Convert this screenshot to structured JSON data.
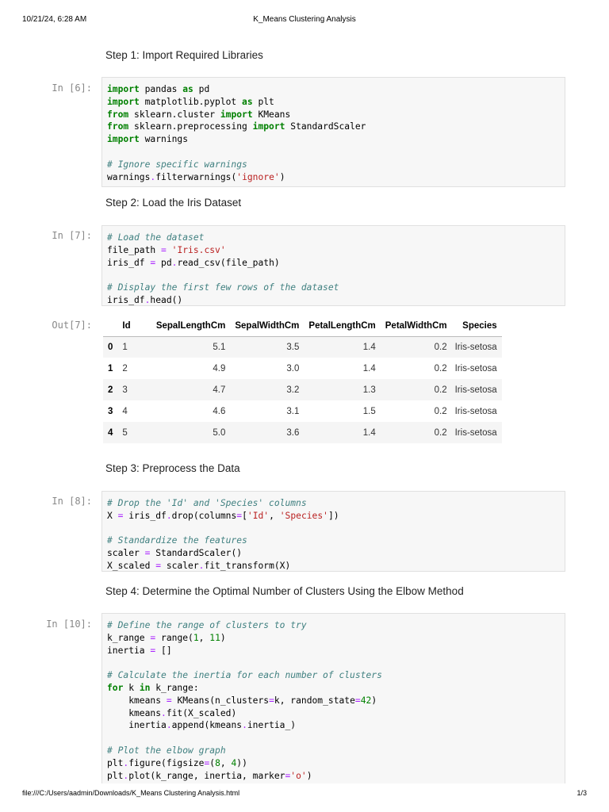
{
  "header": {
    "datetime": "10/21/24, 6:28 AM",
    "title": "K_Means Clustering Analysis"
  },
  "footer": {
    "path": "file:///C:/Users/aadmin/Downloads/K_Means Clustering Analysis.html",
    "page": "1/3"
  },
  "steps": [
    "Step 1: Import Required Libraries",
    "Step 2: Load the Iris Dataset",
    "Step 3: Preprocess the Data",
    "Step 4: Determine the Optimal Number of Clusters Using the Elbow Method"
  ],
  "cells": [
    {
      "prompt": "In [6]:",
      "lines": [
        [
          [
            "k",
            "import"
          ],
          [
            "p",
            " pandas "
          ],
          [
            "k",
            "as"
          ],
          [
            "p",
            " pd"
          ]
        ],
        [
          [
            "k",
            "import"
          ],
          [
            "p",
            " matplotlib.pyplot "
          ],
          [
            "k",
            "as"
          ],
          [
            "p",
            " plt"
          ]
        ],
        [
          [
            "k",
            "from"
          ],
          [
            "p",
            " sklearn.cluster "
          ],
          [
            "k",
            "import"
          ],
          [
            "p",
            " KMeans"
          ]
        ],
        [
          [
            "k",
            "from"
          ],
          [
            "p",
            " sklearn.preprocessing "
          ],
          [
            "k",
            "import"
          ],
          [
            "p",
            " StandardScaler"
          ]
        ],
        [
          [
            "k",
            "import"
          ],
          [
            "p",
            " warnings"
          ]
        ],
        [],
        [
          [
            "c",
            "# Ignore specific warnings"
          ]
        ],
        [
          [
            "p",
            "warnings"
          ],
          [
            "o",
            "."
          ],
          [
            "p",
            "filterwarnings("
          ],
          [
            "s",
            "'ignore'"
          ],
          [
            "p",
            ")"
          ]
        ]
      ]
    },
    {
      "prompt": "In [7]:",
      "lines": [
        [
          [
            "c",
            "# Load the dataset"
          ]
        ],
        [
          [
            "p",
            "file_path "
          ],
          [
            "o",
            "="
          ],
          [
            "p",
            " "
          ],
          [
            "s",
            "'Iris.csv'"
          ]
        ],
        [
          [
            "p",
            "iris_df "
          ],
          [
            "o",
            "="
          ],
          [
            "p",
            " pd"
          ],
          [
            "o",
            "."
          ],
          [
            "p",
            "read_csv(file_path)"
          ]
        ],
        [],
        [
          [
            "c",
            "# Display the first few rows of the dataset"
          ]
        ],
        [
          [
            "p",
            "iris_df"
          ],
          [
            "o",
            "."
          ],
          [
            "p",
            "head()"
          ]
        ]
      ]
    },
    {
      "prompt": "In [8]:",
      "lines": [
        [
          [
            "c",
            "# Drop the 'Id' and 'Species' columns"
          ]
        ],
        [
          [
            "p",
            "X "
          ],
          [
            "o",
            "="
          ],
          [
            "p",
            " iris_df"
          ],
          [
            "o",
            "."
          ],
          [
            "p",
            "drop(columns"
          ],
          [
            "o",
            "="
          ],
          [
            "p",
            "["
          ],
          [
            "s",
            "'Id'"
          ],
          [
            "p",
            ", "
          ],
          [
            "s",
            "'Species'"
          ],
          [
            "p",
            "])"
          ]
        ],
        [],
        [
          [
            "c",
            "# Standardize the features"
          ]
        ],
        [
          [
            "p",
            "scaler "
          ],
          [
            "o",
            "="
          ],
          [
            "p",
            " StandardScaler()"
          ]
        ],
        [
          [
            "p",
            "X_scaled "
          ],
          [
            "o",
            "="
          ],
          [
            "p",
            " scaler"
          ],
          [
            "o",
            "."
          ],
          [
            "p",
            "fit_transform(X)"
          ]
        ]
      ]
    },
    {
      "prompt": "In [10]:",
      "lines": [
        [
          [
            "c",
            "# Define the range of clusters to try"
          ]
        ],
        [
          [
            "p",
            "k_range "
          ],
          [
            "o",
            "="
          ],
          [
            "p",
            " range("
          ],
          [
            "n",
            "1"
          ],
          [
            "p",
            ", "
          ],
          [
            "n",
            "11"
          ],
          [
            "p",
            ")"
          ]
        ],
        [
          [
            "p",
            "inertia "
          ],
          [
            "o",
            "="
          ],
          [
            "p",
            " []"
          ]
        ],
        [],
        [
          [
            "c",
            "# Calculate the inertia for each number of clusters"
          ]
        ],
        [
          [
            "k",
            "for"
          ],
          [
            "p",
            " k "
          ],
          [
            "k",
            "in"
          ],
          [
            "p",
            " k_range:"
          ]
        ],
        [
          [
            "p",
            "    kmeans "
          ],
          [
            "o",
            "="
          ],
          [
            "p",
            " KMeans(n_clusters"
          ],
          [
            "o",
            "="
          ],
          [
            "p",
            "k, random_state"
          ],
          [
            "o",
            "="
          ],
          [
            "n",
            "42"
          ],
          [
            "p",
            ")"
          ]
        ],
        [
          [
            "p",
            "    kmeans"
          ],
          [
            "o",
            "."
          ],
          [
            "p",
            "fit(X_scaled)"
          ]
        ],
        [
          [
            "p",
            "    inertia"
          ],
          [
            "o",
            "."
          ],
          [
            "p",
            "append(kmeans"
          ],
          [
            "o",
            "."
          ],
          [
            "p",
            "inertia_)"
          ]
        ],
        [],
        [
          [
            "c",
            "# Plot the elbow graph"
          ]
        ],
        [
          [
            "p",
            "plt"
          ],
          [
            "o",
            "."
          ],
          [
            "p",
            "figure(figsize"
          ],
          [
            "o",
            "="
          ],
          [
            "p",
            "("
          ],
          [
            "n",
            "8"
          ],
          [
            "p",
            ", "
          ],
          [
            "n",
            "4"
          ],
          [
            "p",
            "))"
          ]
        ],
        [
          [
            "p",
            "plt"
          ],
          [
            "o",
            "."
          ],
          [
            "p",
            "plot(k_range, inertia, marker"
          ],
          [
            "o",
            "="
          ],
          [
            "s",
            "'o'"
          ],
          [
            "p",
            ")"
          ]
        ]
      ]
    }
  ],
  "output": {
    "prompt": "Out[7]:",
    "columns": [
      "",
      "Id",
      "SepalLengthCm",
      "SepalWidthCm",
      "PetalLengthCm",
      "PetalWidthCm",
      "Species"
    ],
    "rows": [
      [
        "0",
        "1",
        "5.1",
        "3.5",
        "1.4",
        "0.2",
        "Iris-setosa"
      ],
      [
        "1",
        "2",
        "4.9",
        "3.0",
        "1.4",
        "0.2",
        "Iris-setosa"
      ],
      [
        "2",
        "3",
        "4.7",
        "3.2",
        "1.3",
        "0.2",
        "Iris-setosa"
      ],
      [
        "3",
        "4",
        "4.6",
        "3.1",
        "1.5",
        "0.2",
        "Iris-setosa"
      ],
      [
        "4",
        "5",
        "5.0",
        "3.6",
        "1.4",
        "0.2",
        "Iris-setosa"
      ]
    ]
  }
}
